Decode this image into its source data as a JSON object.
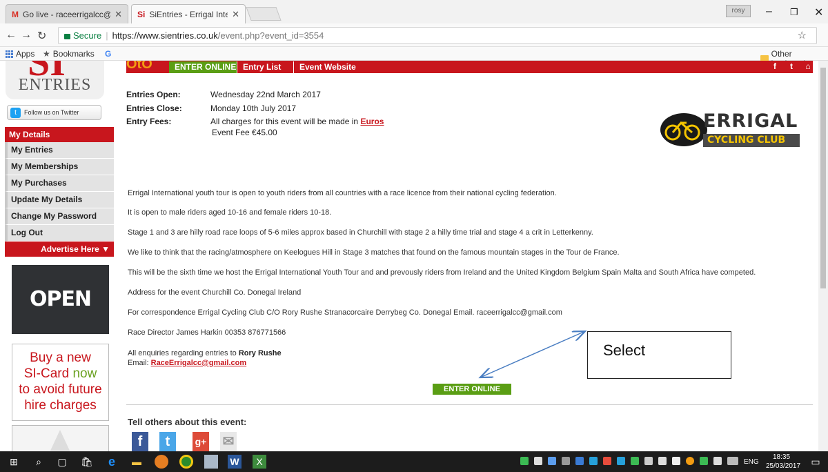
{
  "browser": {
    "tabs": [
      {
        "icon": "M",
        "title": "Go live - raceerrigalcc@g"
      },
      {
        "icon": "Si",
        "title": "SiEntries - Errigal Interna"
      }
    ],
    "profile": "rosy",
    "secure_label": "Secure",
    "url_host": "https://www.sientries.co.uk",
    "url_rest": "/event.php?event_id=3554",
    "bookmarks": {
      "apps": "Apps",
      "bookmarks": "Bookmarks",
      "other": "Other bookmarks"
    }
  },
  "sidebar": {
    "logo_text": "ENTRIES",
    "twitter_label": "Follow us on Twitter",
    "menu_header": "My Details",
    "menu_items": [
      "My Entries",
      "My Memberships",
      "My Purchases",
      "Update My Details",
      "Change My Password",
      "Log Out"
    ],
    "advertise": "Advertise Here ▼",
    "open_now": "OPEN NOW",
    "sicard_lines": [
      "Buy a new",
      "SI-Card",
      "now",
      "to avoid future",
      "hire charges"
    ]
  },
  "nav": {
    "enter_online": "ENTER ONLINE",
    "entry_list": "Entry List",
    "event_website": "Event Website"
  },
  "event": {
    "entries_open_label": "Entries Open:",
    "entries_open": "Wednesday 22nd March 2017",
    "entries_close_label": "Entries Close:",
    "entries_close": "Monday 10th July 2017",
    "entry_fees_label": "Entry Fees:",
    "fees_text": "All charges for this event will be made in",
    "fees_currency": "Euros",
    "event_fee": "Event Fee  €45.00",
    "logo_line1": "ERRIGAL",
    "logo_line2": "CYCLING CLUB",
    "paragraphs": [
      "Errigal International youth tour is open to youth riders from all countries with a race licence from their national cycling federation.",
      "It is open to  male riders aged 10-16 and female riders 10-18.",
      "Stage 1 and 3 are  hilly road race loops of 5-6 miles approx based in Churchill with stage 2 a hilly time trial and stage 4 a crit in Letterkenny.",
      "We like to think that the racing/atmosphere on Keelogues Hill in Stage 3 matches that found on the famous mountain stages in the Tour de  France.",
      "This will be the sixth time we host the Errigal International Youth Tour and and prevously riders from Ireland and the United Kingdom Belgium Spain Malta and South Africa have competed.",
      "Address for the event Churchill Co. Donegal  Ireland",
      "For correspondence Errigal Cycling Club C/O Rory Rushe Stranacorcaire Derrybeg Co. Donegal  Email. raceerrigalcc@gmail.com",
      " Race Director James Harkin 00353 876771566"
    ],
    "enquiries_prefix": "All enquiries regarding entries to",
    "enquiries_name": "Rory Rushe",
    "email_label": "Email:",
    "email": "RaceErrigalcc@gmail.com",
    "enter_button": "ENTER ONLINE",
    "tell_others": "Tell others about this event:"
  },
  "annotation": {
    "label": "Select"
  },
  "taskbar": {
    "lang": "ENG",
    "time": "18:35",
    "date": "25/03/2017"
  },
  "colors": {
    "brand_red": "#c8161d",
    "enter_green": "#5a9e14",
    "annotation_arrow": "#4a7ec2"
  }
}
